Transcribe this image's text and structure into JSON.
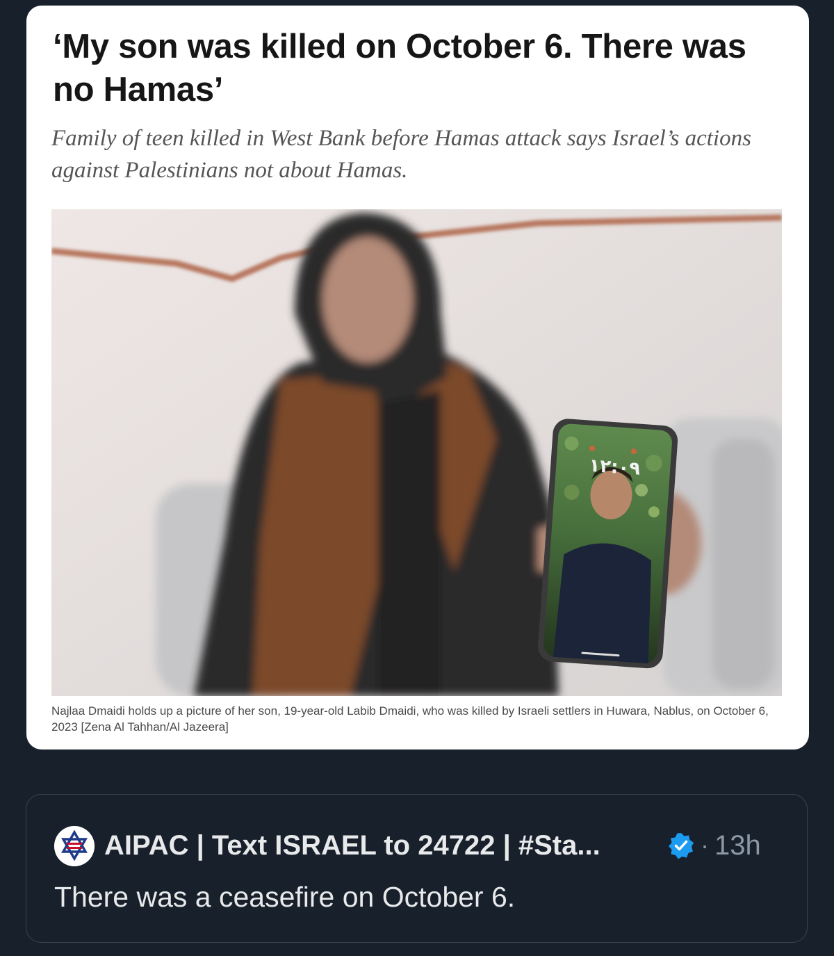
{
  "article": {
    "headline": "‘My son was killed on October 6. There was no Hamas’",
    "subhead": "Family of teen killed in West Bank before Hamas attack says Israel’s actions against Palestinians not about Hamas.",
    "caption": "Najlaa Dmaidi holds up a picture of her son, 19-year-old Labib Dmaidi, who was killed by Israeli settlers in Huwara, Nablus, on October 6, 2023 [Zena Al Tahhan/Al Jazeera]",
    "phone_clock": "١٢:٠٩"
  },
  "quoted_tweet": {
    "author": "AIPAC | Text ISRAEL to 24722 | #Sta...",
    "separator": "·",
    "time": "13h",
    "text": "There was a ceasefire on October 6.",
    "avatar_icon": "aipac-logo-icon",
    "verified_icon": "verified-badge-icon"
  },
  "colors": {
    "page_background": "#18202b",
    "card_background": "#ffffff",
    "verified_blue": "#1d9bf0",
    "muted_text": "#8b98a5"
  }
}
